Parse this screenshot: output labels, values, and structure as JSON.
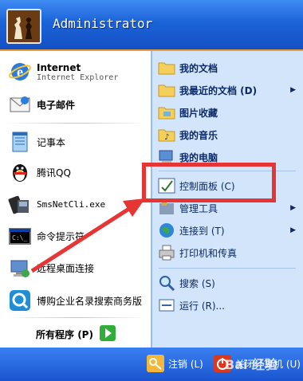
{
  "user": {
    "name": "Administrator"
  },
  "left_items": [
    {
      "label": "Internet",
      "sub": "Internet Explorer"
    },
    {
      "label": "电子邮件"
    },
    {
      "label": "记事本"
    },
    {
      "label": "腾讯QQ"
    },
    {
      "label": "SmsNetCli.exe"
    },
    {
      "label": "命令提示符"
    },
    {
      "label": "远程桌面连接"
    },
    {
      "label": "博购企业名录搜索商务版"
    }
  ],
  "all_programs": "所有程序 (P)",
  "right_items": [
    {
      "label": "我的文档"
    },
    {
      "label": "我最近的文档 (D)"
    },
    {
      "label": "图片收藏"
    },
    {
      "label": "我的音乐"
    },
    {
      "label": "我的电脑"
    },
    {
      "label": "控制面板 (C)"
    },
    {
      "label": "管理工具"
    },
    {
      "label": "连接到 (T)"
    },
    {
      "label": "打印机和传真"
    },
    {
      "label": "搜索 (S)"
    },
    {
      "label": "运行 (R)..."
    }
  ],
  "footer": {
    "logoff": "注销 (L)",
    "shutdown": "关闭计算机 (U)"
  },
  "watermark": "Bai 经验",
  "colors": {
    "highlight": "#e53535",
    "header": "#1b63d8",
    "right_pane": "#d3e5fa"
  }
}
